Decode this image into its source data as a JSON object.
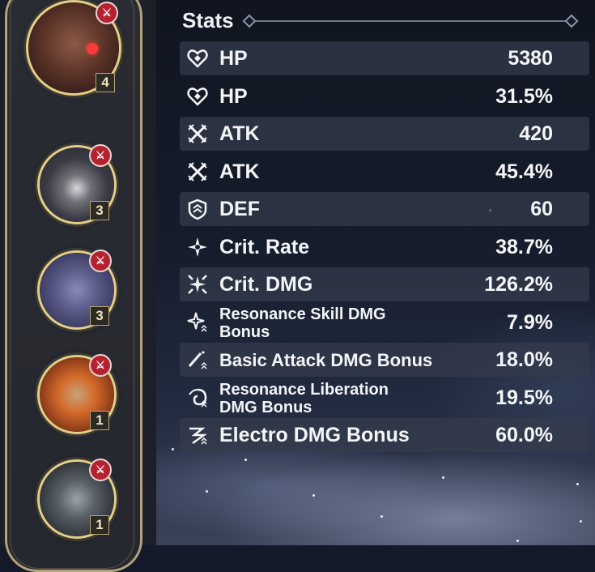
{
  "stats_header": {
    "title": "Stats"
  },
  "stats": [
    {
      "name": "HP",
      "value": "5380",
      "icon": "hp-icon"
    },
    {
      "name": "HP",
      "value": "31.5%",
      "icon": "hp-icon"
    },
    {
      "name": "ATK",
      "value": "420",
      "icon": "atk-icon"
    },
    {
      "name": "ATK",
      "value": "45.4%",
      "icon": "atk-icon"
    },
    {
      "name": "DEF",
      "value": "60",
      "icon": "def-icon"
    },
    {
      "name": "Crit. Rate",
      "value": "38.7%",
      "icon": "crit-rate-icon"
    },
    {
      "name": "Crit. DMG",
      "value": "126.2%",
      "icon": "crit-dmg-icon"
    },
    {
      "name": "Resonance Skill DMG Bonus",
      "value": "7.9%",
      "icon": "resonance-skill-icon"
    },
    {
      "name": "Basic Attack DMG Bonus",
      "value": "18.0%",
      "icon": "basic-attack-icon"
    },
    {
      "name": "Resonance Liberation DMG Bonus",
      "value": "19.5%",
      "icon": "resonance-liberation-icon"
    },
    {
      "name": "Electro DMG Bonus",
      "value": "60.0%",
      "icon": "electro-icon"
    }
  ],
  "echoes": [
    {
      "cost": "4",
      "icon": "echo-icon"
    },
    {
      "cost": "3",
      "icon": "echo-icon"
    },
    {
      "cost": "3",
      "icon": "echo-icon"
    },
    {
      "cost": "1",
      "icon": "echo-icon"
    },
    {
      "cost": "1",
      "icon": "echo-icon"
    }
  ],
  "colors": {
    "frame_gold": "#e4cf86",
    "lock_red": "#b4222f",
    "text": "#f4f5f8",
    "row_band": "#343c4c"
  }
}
